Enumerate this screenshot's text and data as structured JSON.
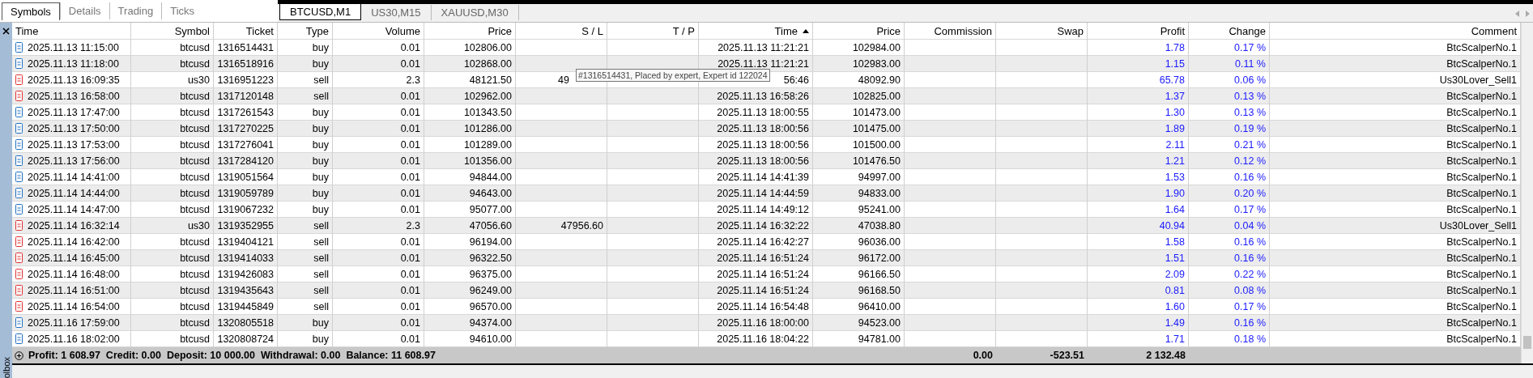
{
  "symbol_tabs": [
    {
      "label": "Symbols",
      "selected": true
    },
    {
      "label": "Details",
      "selected": false
    },
    {
      "label": "Trading",
      "selected": false
    },
    {
      "label": "Ticks",
      "selected": false
    }
  ],
  "chart_tabs": [
    {
      "label": "BTCUSD,M1",
      "selected": true
    },
    {
      "label": "US30,M15",
      "selected": false
    },
    {
      "label": "XAUUSD,M30",
      "selected": false
    }
  ],
  "table": {
    "columns": [
      {
        "label": "Time",
        "sorted": false
      },
      {
        "label": "Symbol",
        "sorted": false
      },
      {
        "label": "Ticket",
        "sorted": false
      },
      {
        "label": "Type",
        "sorted": false
      },
      {
        "label": "Volume",
        "sorted": false
      },
      {
        "label": "Price",
        "sorted": false
      },
      {
        "label": "S / L",
        "sorted": false
      },
      {
        "label": "T / P",
        "sorted": false
      },
      {
        "label": "Time",
        "sorted": true
      },
      {
        "label": "Price",
        "sorted": false
      },
      {
        "label": "Commission",
        "sorted": false
      },
      {
        "label": "Swap",
        "sorted": false
      },
      {
        "label": "Profit",
        "sorted": false
      },
      {
        "label": "Change",
        "sorted": false
      },
      {
        "label": "Comment",
        "sorted": false
      }
    ],
    "rows": [
      {
        "kind": "buy",
        "open_time": "2025.11.13 11:15:00",
        "symbol": "btcusd",
        "ticket": "1316514431",
        "type": "buy",
        "volume": "0.01",
        "open_price": "102806.00",
        "close_time": "2025.11.13 11:21:21",
        "close_price": "102984.00",
        "profit": "1.78",
        "change": "0.17 %",
        "comment": "BtcScalperNo.1"
      },
      {
        "kind": "buy",
        "open_time": "2025.11.13 11:18:00",
        "symbol": "btcusd",
        "ticket": "1316518916",
        "type": "buy",
        "volume": "0.01",
        "open_price": "102868.00",
        "close_time": "2025.11.13 11:21:21",
        "close_price": "102983.00",
        "profit": "1.15",
        "change": "0.11 %",
        "comment": "BtcScalperNo.1"
      },
      {
        "kind": "sell",
        "partly_hidden": true,
        "open_time": "2025.11.13 16:09:35",
        "symbol": "us30",
        "ticket": "1316951223",
        "type": "sell",
        "volume": "2.3",
        "open_price": "48121.50",
        "sl": "49",
        "close_time": "56:46",
        "close_price": "48092.90",
        "profit": "65.78",
        "change": "0.06 %",
        "comment": "Us30Lover_Sell1"
      },
      {
        "kind": "sell",
        "open_time": "2025.11.13 16:58:00",
        "symbol": "btcusd",
        "ticket": "1317120148",
        "type": "sell",
        "volume": "0.01",
        "open_price": "102962.00",
        "close_time": "2025.11.13 16:58:26",
        "close_price": "102825.00",
        "profit": "1.37",
        "change": "0.13 %",
        "comment": "BtcScalperNo.1"
      },
      {
        "kind": "buy",
        "open_time": "2025.11.13 17:47:00",
        "symbol": "btcusd",
        "ticket": "1317261543",
        "type": "buy",
        "volume": "0.01",
        "open_price": "101343.50",
        "close_time": "2025.11.13 18:00:55",
        "close_price": "101473.00",
        "profit": "1.30",
        "change": "0.13 %",
        "comment": "BtcScalperNo.1"
      },
      {
        "kind": "buy",
        "open_time": "2025.11.13 17:50:00",
        "symbol": "btcusd",
        "ticket": "1317270225",
        "type": "buy",
        "volume": "0.01",
        "open_price": "101286.00",
        "close_time": "2025.11.13 18:00:56",
        "close_price": "101475.00",
        "profit": "1.89",
        "change": "0.19 %",
        "comment": "BtcScalperNo.1"
      },
      {
        "kind": "buy",
        "open_time": "2025.11.13 17:53:00",
        "symbol": "btcusd",
        "ticket": "1317276041",
        "type": "buy",
        "volume": "0.01",
        "open_price": "101289.00",
        "close_time": "2025.11.13 18:00:56",
        "close_price": "101500.00",
        "profit": "2.11",
        "change": "0.21 %",
        "comment": "BtcScalperNo.1"
      },
      {
        "kind": "buy",
        "open_time": "2025.11.13 17:56:00",
        "symbol": "btcusd",
        "ticket": "1317284120",
        "type": "buy",
        "volume": "0.01",
        "open_price": "101356.00",
        "close_time": "2025.11.13 18:00:56",
        "close_price": "101476.50",
        "profit": "1.21",
        "change": "0.12 %",
        "comment": "BtcScalperNo.1"
      },
      {
        "kind": "buy",
        "open_time": "2025.11.14 14:41:00",
        "symbol": "btcusd",
        "ticket": "1319051564",
        "type": "buy",
        "volume": "0.01",
        "open_price": "94844.00",
        "close_time": "2025.11.14 14:41:39",
        "close_price": "94997.00",
        "profit": "1.53",
        "change": "0.16 %",
        "comment": "BtcScalperNo.1"
      },
      {
        "kind": "buy",
        "open_time": "2025.11.14 14:44:00",
        "symbol": "btcusd",
        "ticket": "1319059789",
        "type": "buy",
        "volume": "0.01",
        "open_price": "94643.00",
        "close_time": "2025.11.14 14:44:59",
        "close_price": "94833.00",
        "profit": "1.90",
        "change": "0.20 %",
        "comment": "BtcScalperNo.1"
      },
      {
        "kind": "buy",
        "open_time": "2025.11.14 14:47:00",
        "symbol": "btcusd",
        "ticket": "1319067232",
        "type": "buy",
        "volume": "0.01",
        "open_price": "95077.00",
        "close_time": "2025.11.14 14:49:12",
        "close_price": "95241.00",
        "profit": "1.64",
        "change": "0.17 %",
        "comment": "BtcScalperNo.1"
      },
      {
        "kind": "sell",
        "open_time": "2025.11.14 16:32:14",
        "symbol": "us30",
        "ticket": "1319352955",
        "type": "sell",
        "volume": "2.3",
        "open_price": "47056.60",
        "sl": "47956.60",
        "close_time": "2025.11.14 16:32:22",
        "close_price": "47038.80",
        "profit": "40.94",
        "change": "0.04 %",
        "comment": "Us30Lover_Sell1"
      },
      {
        "kind": "sell",
        "open_time": "2025.11.14 16:42:00",
        "symbol": "btcusd",
        "ticket": "1319404121",
        "type": "sell",
        "volume": "0.01",
        "open_price": "96194.00",
        "close_time": "2025.11.14 16:42:27",
        "close_price": "96036.00",
        "profit": "1.58",
        "change": "0.16 %",
        "comment": "BtcScalperNo.1"
      },
      {
        "kind": "sell",
        "open_time": "2025.11.14 16:45:00",
        "symbol": "btcusd",
        "ticket": "1319414033",
        "type": "sell",
        "volume": "0.01",
        "open_price": "96322.50",
        "close_time": "2025.11.14 16:51:24",
        "close_price": "96172.00",
        "profit": "1.51",
        "change": "0.16 %",
        "comment": "BtcScalperNo.1"
      },
      {
        "kind": "sell",
        "open_time": "2025.11.14 16:48:00",
        "symbol": "btcusd",
        "ticket": "1319426083",
        "type": "sell",
        "volume": "0.01",
        "open_price": "96375.00",
        "close_time": "2025.11.14 16:51:24",
        "close_price": "96166.50",
        "profit": "2.09",
        "change": "0.22 %",
        "comment": "BtcScalperNo.1"
      },
      {
        "kind": "sell",
        "open_time": "2025.11.14 16:51:00",
        "symbol": "btcusd",
        "ticket": "1319435643",
        "type": "sell",
        "volume": "0.01",
        "open_price": "96249.00",
        "close_time": "2025.11.14 16:51:24",
        "close_price": "96168.50",
        "profit": "0.81",
        "change": "0.08 %",
        "comment": "BtcScalperNo.1"
      },
      {
        "kind": "sell",
        "open_time": "2025.11.14 16:54:00",
        "symbol": "btcusd",
        "ticket": "1319445849",
        "type": "sell",
        "volume": "0.01",
        "open_price": "96570.00",
        "close_time": "2025.11.14 16:54:48",
        "close_price": "96410.00",
        "profit": "1.60",
        "change": "0.17 %",
        "comment": "BtcScalperNo.1"
      },
      {
        "kind": "buy",
        "open_time": "2025.11.16 17:59:00",
        "symbol": "btcusd",
        "ticket": "1320805518",
        "type": "buy",
        "volume": "0.01",
        "open_price": "94374.00",
        "close_time": "2025.11.16 18:00:00",
        "close_price": "94523.00",
        "profit": "1.49",
        "change": "0.16 %",
        "comment": "BtcScalperNo.1"
      },
      {
        "kind": "buy",
        "open_time": "2025.11.16 18:02:00",
        "symbol": "btcusd",
        "ticket": "1320808724",
        "type": "buy",
        "volume": "0.01",
        "open_price": "94610.00",
        "close_time": "2025.11.16 18:04:22",
        "close_price": "94781.00",
        "profit": "1.71",
        "change": "0.18 %",
        "comment": "BtcScalperNo.1"
      }
    ]
  },
  "summary": {
    "text": "Profit: 1 608.97  Credit: 0.00  Deposit: 10 000.00  Withdrawal: 0.00  Balance: 11 608.97",
    "commission": "0.00",
    "swap": "-523.51",
    "profit": "2 132.48"
  },
  "tooltip": {
    "text": "#1316514431, Placed by expert, Expert id 122024"
  },
  "toolbox": {
    "label": "olbox"
  }
}
